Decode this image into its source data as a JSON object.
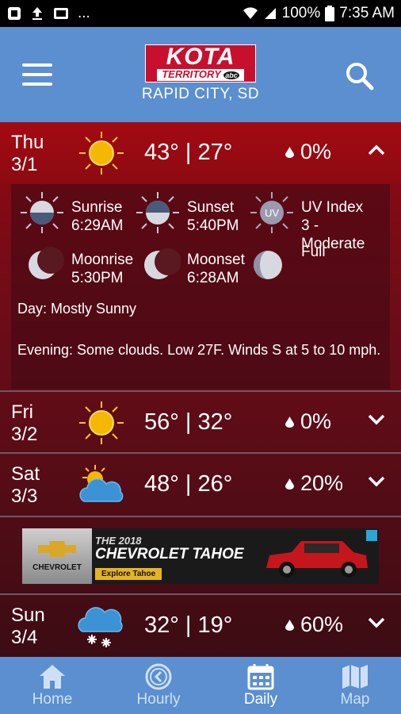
{
  "status_bar": {
    "battery": "100%",
    "time": "7:35 AM",
    "overflow": "..."
  },
  "header": {
    "logo_main": "KOTA",
    "logo_sub": "TERRITORY",
    "logo_badge": "abc",
    "location": "RAPID CITY, SD"
  },
  "days": [
    {
      "day": "Thu",
      "date": "3/1",
      "icon": "sunny-icon",
      "high": "43°",
      "low": "27°",
      "separator": "|",
      "precip": "0%",
      "expanded": true
    },
    {
      "day": "Fri",
      "date": "3/2",
      "icon": "sunny-icon",
      "high": "56°",
      "low": "32°",
      "separator": "|",
      "precip": "0%",
      "expanded": false
    },
    {
      "day": "Sat",
      "date": "3/3",
      "icon": "partly-cloudy-icon",
      "high": "48°",
      "low": "26°",
      "separator": "|",
      "precip": "20%",
      "expanded": false
    },
    {
      "day": "Sun",
      "date": "3/4",
      "icon": "snow-icon",
      "high": "32°",
      "low": "19°",
      "separator": "|",
      "precip": "60%",
      "expanded": false
    }
  ],
  "details": {
    "sunrise_label": "Sunrise",
    "sunrise_time": "6:29AM",
    "sunset_label": "Sunset",
    "sunset_time": "5:40PM",
    "uv_label": "UV Index",
    "uv_value": "3 - Moderate",
    "uv_icon_text": "UV",
    "moonrise_label": "Moonrise",
    "moonrise_time": "5:30PM",
    "moonset_label": "Moonset",
    "moonset_time": "6:28AM",
    "moon_phase": "Full",
    "day_text": "Day: Mostly Sunny",
    "evening_text": "Evening: Some clouds. Low 27F. Winds S at 5 to 10 mph."
  },
  "ad": {
    "brand": "CHEVROLET",
    "year": "THE 2018",
    "model": "CHEVROLET TAHOE",
    "cta": "Explore Tahoe"
  },
  "tabs": [
    {
      "label": "Home",
      "icon": "home-icon",
      "active": false
    },
    {
      "label": "Hourly",
      "icon": "clock-icon",
      "active": false
    },
    {
      "label": "Daily",
      "icon": "calendar-icon",
      "active": true
    },
    {
      "label": "Map",
      "icon": "map-icon",
      "active": false
    }
  ],
  "colors": {
    "header_blue": "#5b8fd0",
    "brand_red": "#c8102e",
    "sun_yellow": "#f5b800"
  }
}
